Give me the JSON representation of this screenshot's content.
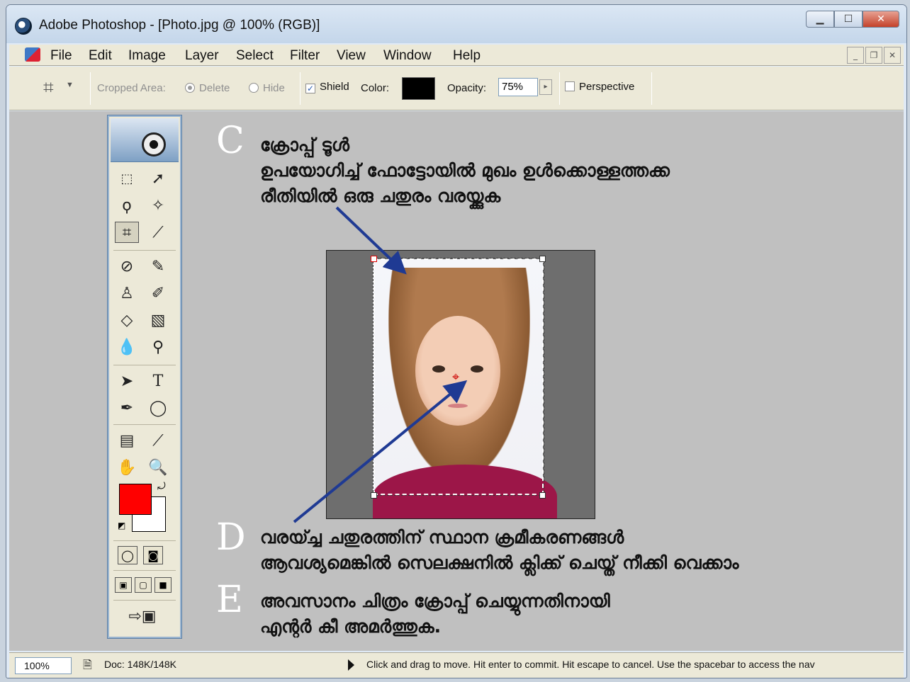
{
  "window": {
    "title": "Adobe Photoshop - [Photo.jpg @ 100% (RGB)]"
  },
  "menu": {
    "items": [
      "File",
      "Edit",
      "Image",
      "Layer",
      "Select",
      "Filter",
      "View",
      "Window",
      "Help"
    ]
  },
  "options": {
    "cropped_area_label": "Cropped Area:",
    "delete_label": "Delete",
    "hide_label": "Hide",
    "shield_label": "Shield",
    "shield_checked": true,
    "color_label": "Color:",
    "shield_color": "#000000",
    "opacity_label": "Opacity:",
    "opacity_value": "75%",
    "perspective_label": "Perspective",
    "perspective_checked": false
  },
  "tools": {
    "foreground_color": "#ff0000",
    "background_color": "#ffffff",
    "selected": "crop-tool"
  },
  "instructions": {
    "c_letter": "C",
    "c_line1": "ക്രോപ്പ് ടൂൾ",
    "c_line2": "ഉപയോഗിച്ച് ഫോട്ടോയിൽ മുഖം ഉൾക്കൊള്ളത്തക്ക",
    "c_line3": "രീതിയിൽ ഒരു ചതുരം വരയ്ക്കുക",
    "d_letter": "D",
    "d_line1": "വരയ്ച്ച ചതുരത്തിന് സ്ഥാന ക്രമീകരണങ്ങൾ",
    "d_line2": "ആവശ്യമെങ്കിൽ സെലക്ഷനിൽ ക്ലിക്ക് ചെയ്ത് നീക്കി വെക്കാം",
    "e_letter": "E",
    "e_line1": "അവസാനം ചിത്രം ക്രോപ്പ് ചെയ്യുന്നതിനായി",
    "e_line2": "എന്റർ കീ അമർത്തുക."
  },
  "status": {
    "zoom": "100%",
    "doc": "Doc: 148K/148K",
    "hint": "Click and drag to move. Hit enter to commit. Hit escape to cancel. Use the spacebar to access the nav"
  },
  "colors": {
    "arrow": "#1f3a93",
    "workspace": "#c0c0c0"
  }
}
